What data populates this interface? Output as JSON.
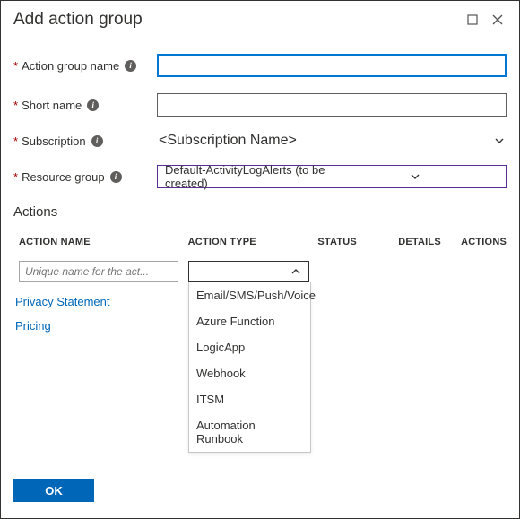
{
  "title": "Add action group",
  "form": {
    "action_group_name": {
      "label": "Action group name",
      "value": ""
    },
    "short_name": {
      "label": "Short name",
      "value": ""
    },
    "subscription": {
      "label": "Subscription",
      "value": "<Subscription Name>"
    },
    "resource_group": {
      "label": "Resource group",
      "value": "Default-ActivityLogAlerts (to be created)"
    }
  },
  "actions": {
    "heading": "Actions",
    "columns": {
      "name": "ACTION NAME",
      "type": "ACTION TYPE",
      "status": "STATUS",
      "details": "DETAILS",
      "actions": "ACTIONS"
    },
    "row": {
      "name_placeholder": "Unique name for the act...",
      "type_value": ""
    },
    "type_options": [
      "Email/SMS/Push/Voice",
      "Azure Function",
      "LogicApp",
      "Webhook",
      "ITSM",
      "Automation Runbook"
    ]
  },
  "links": {
    "privacy": "Privacy Statement",
    "pricing": "Pricing"
  },
  "footer": {
    "ok": "OK"
  }
}
